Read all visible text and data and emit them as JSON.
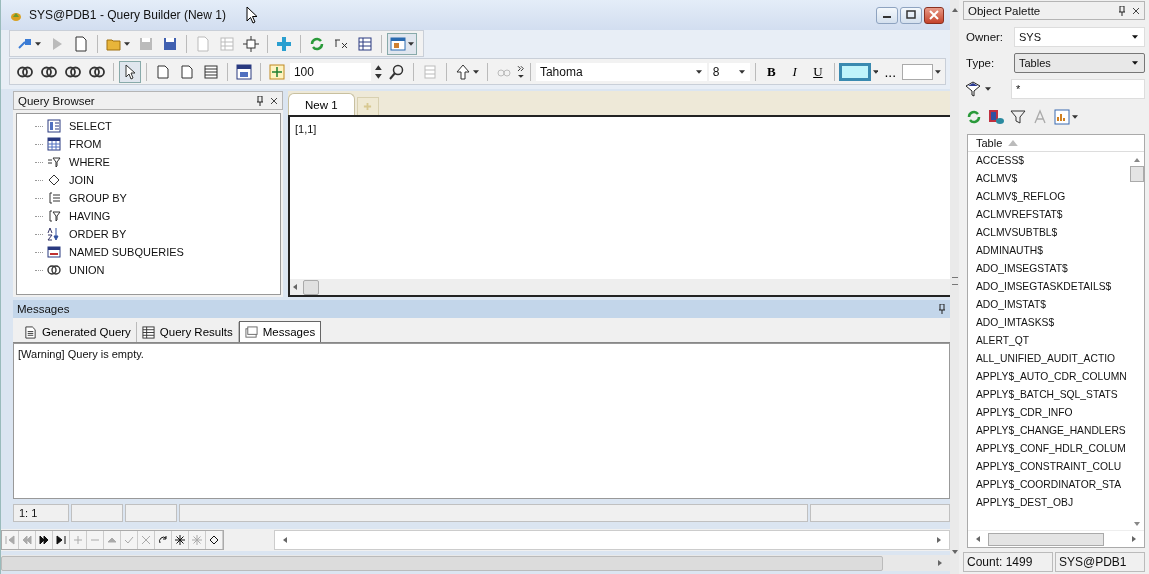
{
  "window": {
    "title": "SYS@PDB1 - Query Builder (New 1)"
  },
  "toolbar": {
    "zoom": "100",
    "font": "Tahoma",
    "font_size": "8",
    "bold": "B",
    "italic": "I",
    "underline": "U",
    "more": "..."
  },
  "query_browser": {
    "title": "Query Browser",
    "items": [
      {
        "label": "SELECT"
      },
      {
        "label": "FROM"
      },
      {
        "label": "WHERE"
      },
      {
        "label": "JOIN"
      },
      {
        "label": "GROUP BY"
      },
      {
        "label": "HAVING"
      },
      {
        "label": "ORDER BY"
      },
      {
        "label": "NAMED SUBQUERIES"
      },
      {
        "label": "UNION"
      }
    ]
  },
  "editor": {
    "tabs": [
      {
        "label": "New 1",
        "selected": true
      }
    ],
    "position": "[1,1]"
  },
  "messages": {
    "title": "Messages",
    "tabs": [
      {
        "label": "Generated Query",
        "selected": false
      },
      {
        "label": "Query Results",
        "selected": false
      },
      {
        "label": "Messages",
        "selected": true
      }
    ],
    "lines": [
      "[Warning] Query is empty."
    ]
  },
  "status_bar": [
    "1:  1"
  ],
  "object_palette": {
    "title": "Object Palette",
    "owner_label": "Owner:",
    "owner": "SYS",
    "type_label": "Type:",
    "type": "Tables",
    "filter": "*",
    "column": "Table",
    "rows": [
      "ACCESS$",
      "ACLMV$",
      "ACLMV$_REFLOG",
      "ACLMVREFSTAT$",
      "ACLMVSUBTBL$",
      "ADMINAUTH$",
      "ADO_IMSEGSTAT$",
      "ADO_IMSEGTASKDETAILS$",
      "ADO_IMSTAT$",
      "ADO_IMTASKS$",
      "ALERT_QT",
      "ALL_UNIFIED_AUDIT_ACTIO",
      "APPLY$_AUTO_CDR_COLUMN",
      "APPLY$_BATCH_SQL_STATS",
      "APPLY$_CDR_INFO",
      "APPLY$_CHANGE_HANDLERS",
      "APPLY$_CONF_HDLR_COLUM",
      "APPLY$_CONSTRAINT_COLU",
      "APPLY$_COORDINATOR_STA",
      "APPLY$_DEST_OBJ"
    ],
    "count": "Count: 1499",
    "connection": "SYS@PDB1"
  }
}
